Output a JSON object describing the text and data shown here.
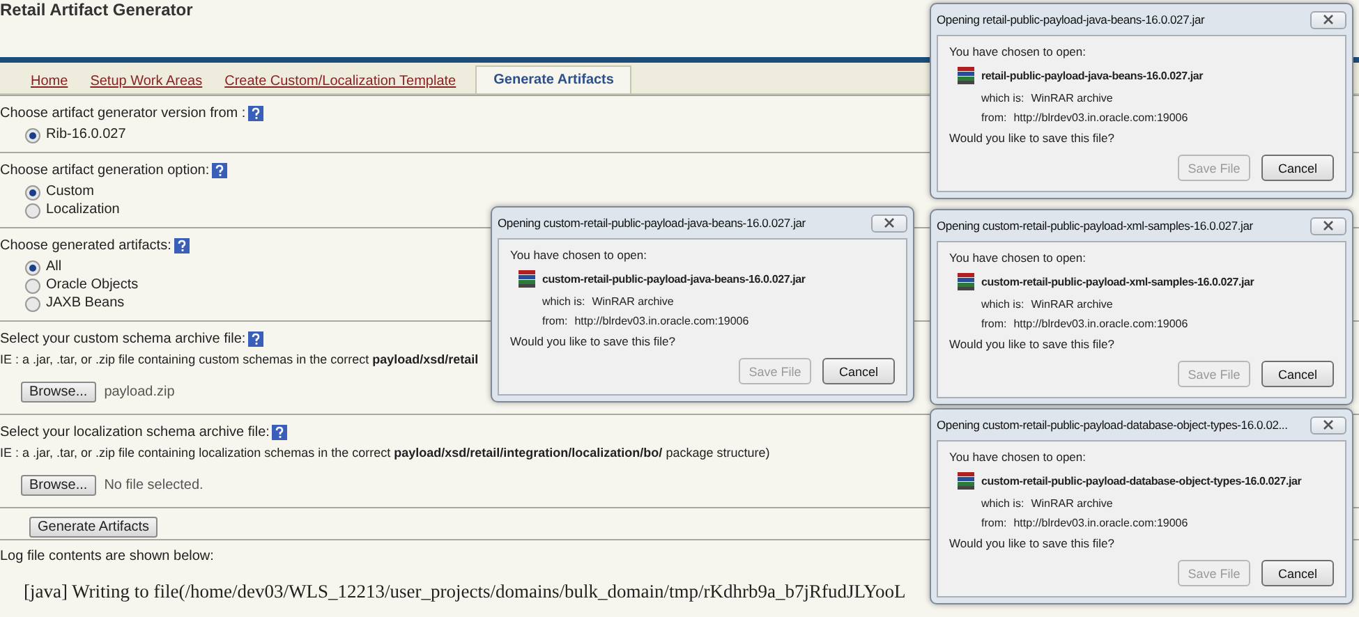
{
  "app_title": "Retail Artifact Generator",
  "tabs": [
    {
      "label": "Home",
      "selected": false
    },
    {
      "label": "Setup Work Areas",
      "selected": false
    },
    {
      "label": "Create Custom/Localization Template",
      "selected": false
    },
    {
      "label": "Generate Artifacts",
      "selected": true
    }
  ],
  "sections": [
    {
      "kind": "radio",
      "label": "Choose artifact generator version from :",
      "options": [
        {
          "label": "Rib-16.0.027",
          "selected": true
        }
      ]
    },
    {
      "kind": "radio",
      "label": "Choose artifact generation option:",
      "options": [
        {
          "label": "Custom",
          "selected": true
        },
        {
          "label": "Localization",
          "selected": false
        }
      ]
    },
    {
      "kind": "radio",
      "label": "Choose generated artifacts:",
      "options": [
        {
          "label": "All",
          "selected": true
        },
        {
          "label": "Oracle Objects",
          "selected": false
        },
        {
          "label": "JAXB Beans",
          "selected": false
        }
      ]
    },
    {
      "kind": "file",
      "label": "Select your custom schema archive file:",
      "hint": "IE : a .jar, .tar, or .zip file containing custom schemas in the correct **payload/xsd/retail**",
      "button": "Browse...",
      "file_name": "payload.zip"
    },
    {
      "kind": "file",
      "label": "Select your localization schema archive file:",
      "hint": "IE : a .jar, .tar, or .zip file containing localization schemas in the correct **payload/xsd/retail/integration/localization/bo/** package structure)",
      "button": "Browse...",
      "file_name": "No file selected."
    }
  ],
  "generate_button": "Generate Artifacts",
  "log_label": "Log file contents are shown below:",
  "log_lines": [
    "[java] Writing to file(/home/dev03/WLS_12213/user_projects/domains/bulk_domain/tmp/rKdhrb9a_b7jRfudJLYooL"
  ],
  "dialogs": [
    {
      "title": "Opening retail-public-payload-java-beans-16.0.027.jar",
      "intro": "You have chosen to open:",
      "file_name": "retail-public-payload-java-beans-16.0.027.jar",
      "type_label": "which is:",
      "type": "WinRAR archive",
      "from_label": "from:",
      "from": "http://blrdev03.in.oracle.com:19006",
      "question": "Would you like to save this file?",
      "buttons": [
        {
          "label": "Save File",
          "disabled": true
        },
        {
          "label": "Cancel",
          "disabled": false
        }
      ]
    },
    {
      "title": "Opening custom-retail-public-payload-java-beans-16.0.027.jar",
      "intro": "You have chosen to open:",
      "file_name": "custom-retail-public-payload-java-beans-16.0.027.jar",
      "type_label": "which is:",
      "type": "WinRAR archive",
      "from_label": "from:",
      "from": "http://blrdev03.in.oracle.com:19006",
      "question": "Would you like to save this file?",
      "buttons": [
        {
          "label": "Save File",
          "disabled": true
        },
        {
          "label": "Cancel",
          "disabled": false
        }
      ]
    },
    {
      "title": "Opening custom-retail-public-payload-xml-samples-16.0.027.jar",
      "intro": "You have chosen to open:",
      "file_name": "custom-retail-public-payload-xml-samples-16.0.027.jar",
      "type_label": "which is:",
      "type": "WinRAR archive",
      "from_label": "from:",
      "from": "http://blrdev03.in.oracle.com:19006",
      "question": "Would you like to save this file?",
      "buttons": [
        {
          "label": "Save File",
          "disabled": true
        },
        {
          "label": "Cancel",
          "disabled": false
        }
      ]
    },
    {
      "title": "Opening custom-retail-public-payload-database-object-types-16.0.02...",
      "intro": "You have chosen to open:",
      "file_name": "custom-retail-public-payload-database-object-types-16.0.027.jar",
      "type_label": "which is:",
      "type": "WinRAR archive",
      "from_label": "from:",
      "from": "http://blrdev03.in.oracle.com:19006",
      "question": "Would you like to save this file?",
      "buttons": [
        {
          "label": "Save File",
          "disabled": true
        },
        {
          "label": "Cancel",
          "disabled": false
        }
      ]
    }
  ]
}
